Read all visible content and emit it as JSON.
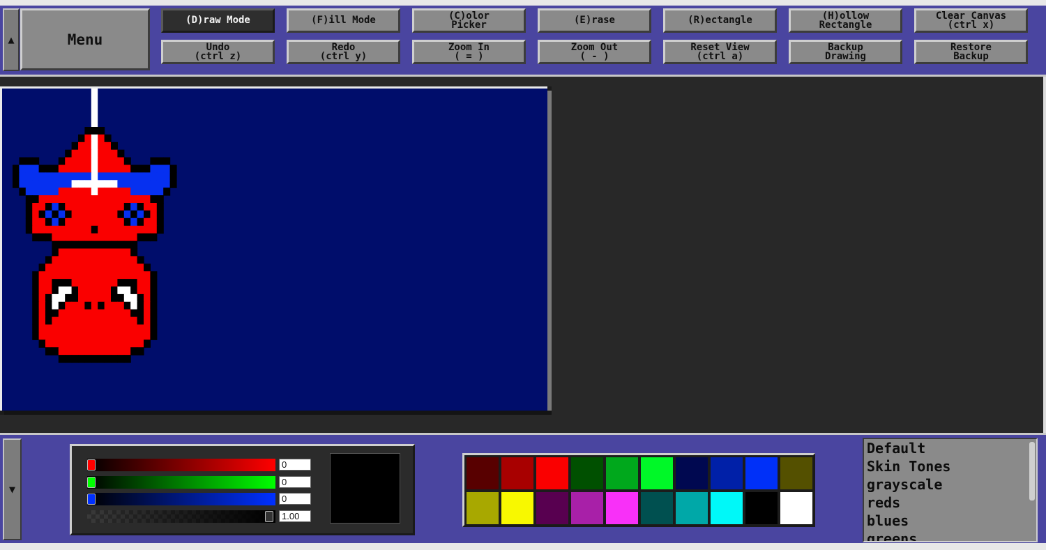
{
  "toolbar": {
    "collapse_icon": "▲",
    "menu_label": "Menu",
    "buttons_row1": [
      {
        "id": "draw-mode",
        "label": "(D)raw Mode",
        "active": true
      },
      {
        "id": "fill-mode",
        "label": "(F)ill Mode",
        "active": false
      },
      {
        "id": "color-picker",
        "label": "(C)olor\nPicker",
        "active": false
      },
      {
        "id": "erase",
        "label": "(E)rase",
        "active": false
      },
      {
        "id": "rectangle",
        "label": "(R)ectangle",
        "active": false
      },
      {
        "id": "hollow-rectangle",
        "label": "(H)ollow\nRectangle",
        "active": false
      },
      {
        "id": "clear-canvas",
        "label": "Clear Canvas\n(ctrl x)",
        "active": false
      }
    ],
    "buttons_row2": [
      {
        "id": "undo",
        "label": "Undo\n(ctrl z)"
      },
      {
        "id": "redo",
        "label": "Redo\n(ctrl y)"
      },
      {
        "id": "zoom-in",
        "label": "Zoom In\n( = )"
      },
      {
        "id": "zoom-out",
        "label": "Zoom Out\n( - )"
      },
      {
        "id": "reset-view",
        "label": "Reset View\n(ctrl a)"
      },
      {
        "id": "backup-drawing",
        "label": "Backup\nDrawing"
      },
      {
        "id": "restore-backup",
        "label": "Restore\nBackup"
      }
    ]
  },
  "canvas": {
    "background_color": "#000d6b",
    "pixel_colors": {
      "K": "#000000",
      "R": "#fa0000",
      "B": "#0630f0",
      "W": "#ffffff"
    },
    "sprite": [
      "...........KKK...........",
      "..........KRWRK..........",
      ".........KRRWRRK.........",
      "........KRRRWRRRK........",
      ".KKK...KRRRRWRRRRK...KKK.",
      "KBBBKKKRRRRRWRRRRRKKKBBBK",
      "KBBBBBBBBBBBWBBBBBBBBBBBK",
      "KBBBBBBBBWWWWWWWBBBBBBBBK",
      ".KBBBBBRRRRRWRRRRRBBBBBK.",
      "..KKRRRRRRRRRRRRRRRRRKK..",
      "..KRRKBKRRRRRRRRRKBKRRK..",
      "..KRKBKBKRRRRRRRKBKBKRK..",
      "..KRRKBKRRRRRRRRRKBKRRK..",
      "..KRRRRRRRRRKRRRRRRRRRK..",
      "...KKKRRRRRRRRRRRRRKKK...",
      "......KKKKKKKKKKKKK......",
      "......KRRRRRRRRRRRK......",
      ".....KRRRRRRRRRRRRRK.....",
      "....KRRRRRRRRRRRRRRRK....",
      "...KRRRRRRRRRRRRRRRRRK...",
      "...KRRKKKRRRRRRRKKKRRK...",
      "...KRRKWWKRRRRRKWWKRRK...",
      "...KRKWWKKRRRRRKKWWKRK...",
      "...KRKWKRRRKRKRRRKWKRK...",
      "...KRKKRRRRRRRRRRRKKRK...",
      "...KRKRRRRRRRRRRRRRKRK...",
      "...KRRRRRRRRRRRRRRRRRK...",
      "...KRRRRRRRRRRRRRRRRRK...",
      "....KRRRRRRRRRRRRRRRK....",
      ".....KKRRRRRRRRRRRKK.....",
      ".......KKKKKKKKKKK......."
    ]
  },
  "color_sliders": {
    "red": {
      "value": "0",
      "color": "#ff0000"
    },
    "green": {
      "value": "0",
      "color": "#00ff00"
    },
    "blue": {
      "value": "0",
      "color": "#0030ff"
    },
    "alpha": {
      "value": "1.00"
    },
    "preview_color": "#000000"
  },
  "palette": {
    "colors": [
      "#580000",
      "#a80000",
      "#fa0000",
      "#005000",
      "#00a81c",
      "#00f828",
      "#000850",
      "#0020a8",
      "#0030f8",
      "#545000",
      "#a8a800",
      "#f8f800",
      "#580050",
      "#a820a8",
      "#f830f8",
      "#005050",
      "#00a8a8",
      "#00f8f8",
      "#000000",
      "#ffffff"
    ]
  },
  "palette_list": {
    "items": [
      "Default",
      "Skin Tones",
      "grayscale",
      "reds",
      "blues",
      "greens"
    ]
  },
  "bottom": {
    "collapse_icon": "▼"
  }
}
